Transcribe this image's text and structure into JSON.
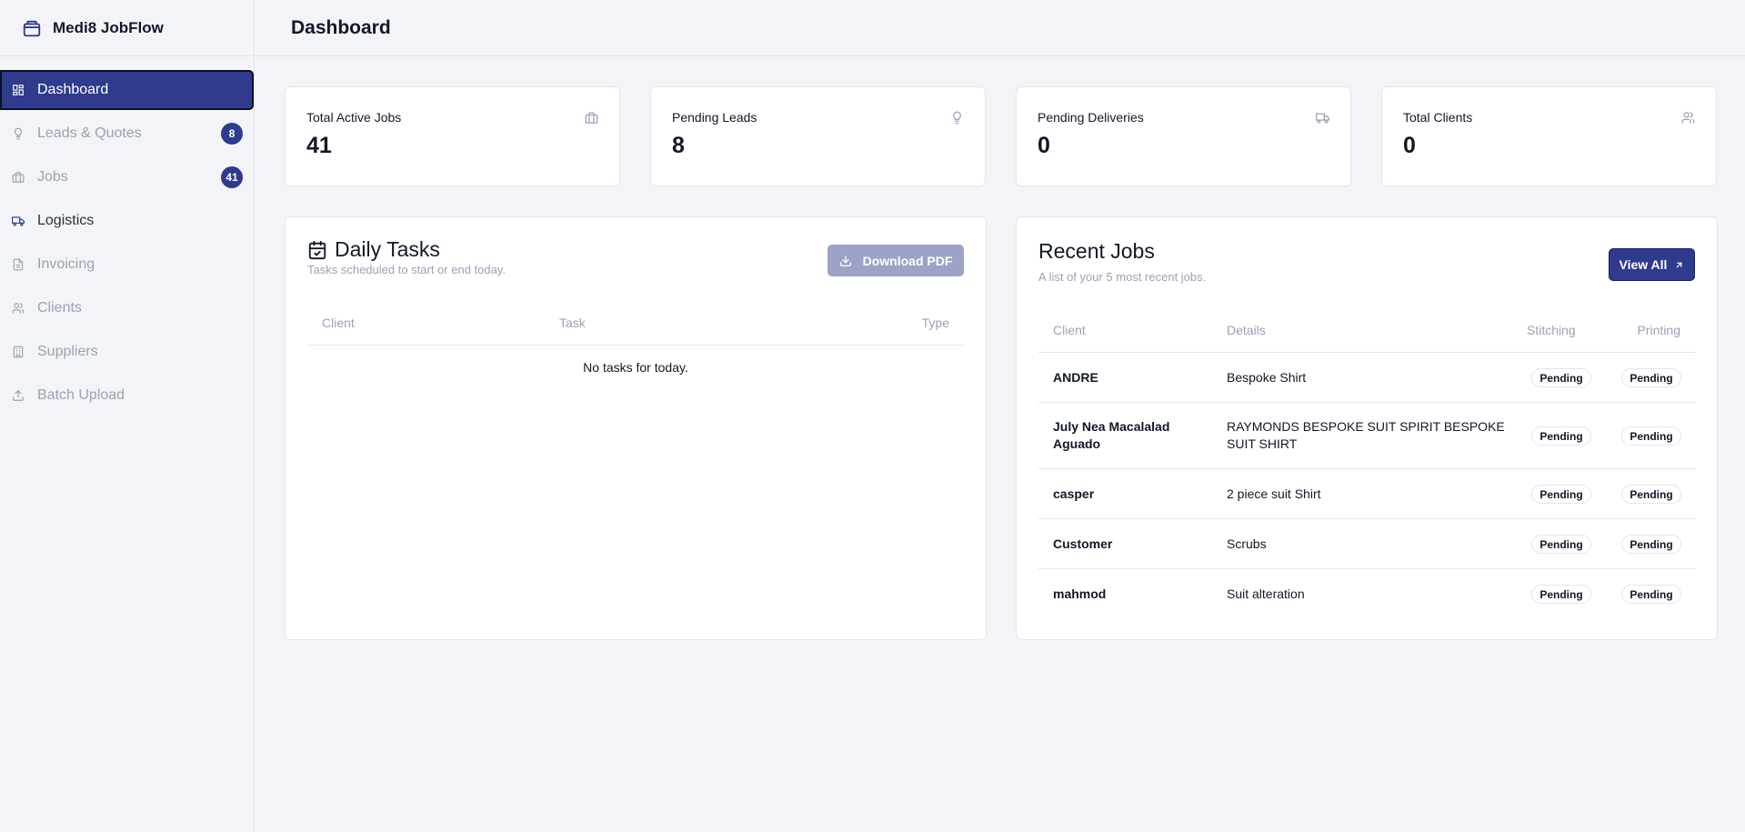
{
  "app": {
    "name": "Medi8 JobFlow"
  },
  "sidebar": {
    "items": [
      {
        "label": "Dashboard",
        "icon": "grid-icon",
        "active": true
      },
      {
        "label": "Leads & Quotes",
        "icon": "lightbulb-icon",
        "badge": "8"
      },
      {
        "label": "Jobs",
        "icon": "briefcase-icon",
        "badge": "41"
      },
      {
        "label": "Logistics",
        "icon": "truck-icon"
      },
      {
        "label": "Invoicing",
        "icon": "document-icon"
      },
      {
        "label": "Clients",
        "icon": "users-icon"
      },
      {
        "label": "Suppliers",
        "icon": "building-icon"
      },
      {
        "label": "Batch Upload",
        "icon": "upload-icon"
      }
    ]
  },
  "header": {
    "title": "Dashboard"
  },
  "stats": [
    {
      "label": "Total Active Jobs",
      "value": "41",
      "icon": "briefcase-icon"
    },
    {
      "label": "Pending Leads",
      "value": "8",
      "icon": "lightbulb-icon"
    },
    {
      "label": "Pending Deliveries",
      "value": "0",
      "icon": "truck-icon"
    },
    {
      "label": "Total Clients",
      "value": "0",
      "icon": "users-icon"
    }
  ],
  "daily_tasks": {
    "title": "Daily Tasks",
    "subtitle": "Tasks scheduled to start or end today.",
    "download_label": "Download PDF",
    "columns": [
      "Client",
      "Task",
      "Type"
    ],
    "empty_message": "No tasks for today."
  },
  "recent_jobs": {
    "title": "Recent Jobs",
    "subtitle": "A list of your 5 most recent jobs.",
    "view_all_label": "View All",
    "columns": [
      "Client",
      "Details",
      "Stitching",
      "Printing"
    ],
    "rows": [
      {
        "client": "ANDRE",
        "details": "Bespoke Shirt",
        "stitching": "Pending",
        "printing": "Pending"
      },
      {
        "client": "July Nea Macalalad Aguado",
        "details": "RAYMONDS BESPOKE SUIT SPIRIT BESPOKE SUIT SHIRT",
        "stitching": "Pending",
        "printing": "Pending"
      },
      {
        "client": "casper",
        "details": "2 piece suit Shirt",
        "stitching": "Pending",
        "printing": "Pending"
      },
      {
        "client": "Customer",
        "details": "Scrubs",
        "stitching": "Pending",
        "printing": "Pending"
      },
      {
        "client": "mahmod",
        "details": "Suit alteration",
        "stitching": "Pending",
        "printing": "Pending"
      }
    ]
  },
  "colors": {
    "accent": "#2f3b8c",
    "muted": "#9aa2b5",
    "disabled_button": "#9ca3c7"
  }
}
